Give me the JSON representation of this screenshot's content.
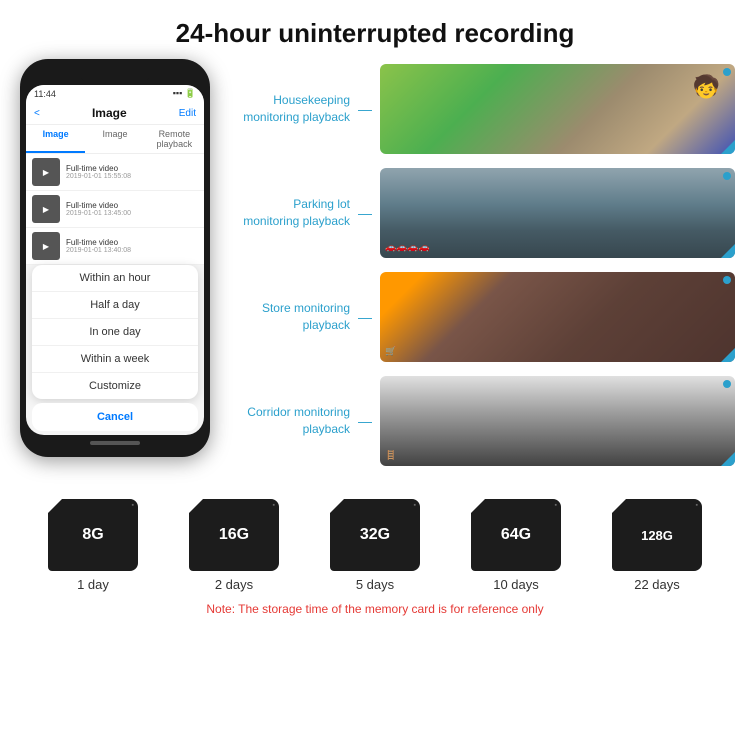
{
  "header": {
    "title": "24-hour uninterrupted recording"
  },
  "phone": {
    "time": "11:44",
    "screen_title": "Image",
    "back_label": "<",
    "edit_label": "Edit",
    "tabs": [
      "Image",
      "Image",
      "Remote playback"
    ],
    "videos": [
      {
        "label": "Full-time video",
        "time": "2019-01-01 15:55:08"
      },
      {
        "label": "Full-time video",
        "time": "2019-01-01 13:45:00"
      },
      {
        "label": "Full-time video",
        "time": "2019-01-01 13:40:08"
      }
    ],
    "dropdown_items": [
      "Within an hour",
      "Half a day",
      "In one day",
      "Within a week",
      "Customize"
    ],
    "cancel_label": "Cancel"
  },
  "scenarios": [
    {
      "label": "Housekeeping\nmonitoring playback",
      "img_class": "img-housekeeping"
    },
    {
      "label": "Parking lot\nmonitoring playback",
      "img_class": "img-parking"
    },
    {
      "label": "Store monitoring\nplayback",
      "img_class": "img-store"
    },
    {
      "label": "Corridor monitoring\nplayback",
      "img_class": "img-corridor"
    }
  ],
  "sd_cards": [
    {
      "size": "8G",
      "days": "1 day"
    },
    {
      "size": "16G",
      "days": "2 days"
    },
    {
      "size": "32G",
      "days": "5 days"
    },
    {
      "size": "64G",
      "days": "10 days"
    },
    {
      "size": "128G",
      "days": "22 days"
    }
  ],
  "note": "Note: The storage time of the memory card is for reference only",
  "colors": {
    "accent": "#2ba0cc",
    "phone_bg": "#1a1a1a",
    "note_color": "#e53935"
  }
}
